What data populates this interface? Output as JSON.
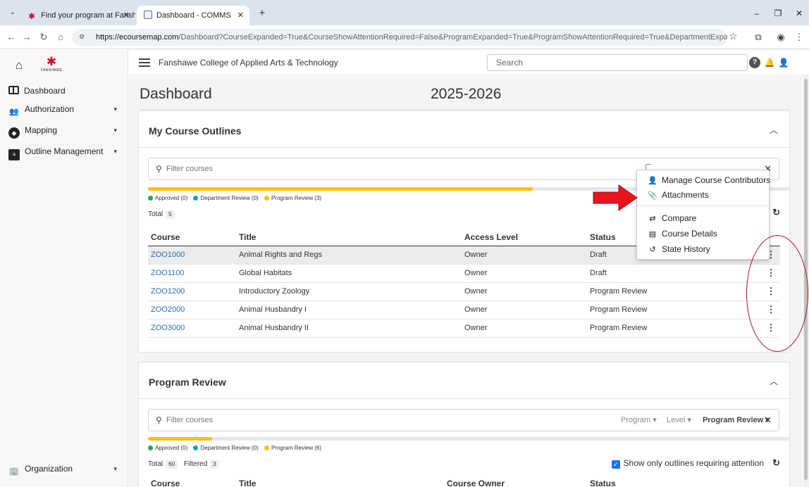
{
  "browser": {
    "tabs": [
      {
        "title": "Find your program at Fanshawe",
        "close": "✕"
      },
      {
        "title": "Dashboard - COMMS",
        "close": "✕"
      }
    ],
    "url_host": "https://ecoursemap.com",
    "url_rest": "/Dashboard?CourseExpanded=True&CourseShowAttentionRequired=False&ProgramExpanded=True&ProgramShowAttentionRequired=True&DepartmentExpanded=True&DepartmentS..."
  },
  "sidebar": {
    "logo_text": "FANSHAWE",
    "items": [
      {
        "label": "Dashboard",
        "icon": "dashboard-icon"
      },
      {
        "label": "Authorization",
        "icon": "users-lock-icon"
      },
      {
        "label": "Mapping",
        "icon": "compass-icon"
      },
      {
        "label": "Outline Management",
        "icon": "book-icon"
      }
    ],
    "footer_item": {
      "label": "Organization",
      "icon": "building-icon"
    }
  },
  "header": {
    "college": "Fanshawe College of Applied Arts & Technology",
    "search_placeholder": "Search"
  },
  "main": {
    "title": "Dashboard",
    "year": "2025-2026"
  },
  "my_outlines": {
    "title": "My Course Outlines",
    "filter_placeholder": "Filter courses",
    "progress_fraction": 0.6,
    "legend": {
      "approved": "Approved (0)",
      "department": "Department Review (0)",
      "program": "Program Review (3)"
    },
    "total_label": "Total",
    "total_count": "5",
    "columns": [
      "Course",
      "Title",
      "Access Level",
      "Status"
    ],
    "rows": [
      {
        "course": "ZOO1000",
        "title": "Animal Rights and Regs",
        "access": "Owner",
        "status": "Draft"
      },
      {
        "course": "ZOO1100",
        "title": "Global Habitats",
        "access": "Owner",
        "status": "Draft"
      },
      {
        "course": "ZOO1200",
        "title": "Introductory Zoology",
        "access": "Owner",
        "status": "Program Review"
      },
      {
        "course": "ZOO2000",
        "title": "Animal Husbandry I",
        "access": "Owner",
        "status": "Program Review"
      },
      {
        "course": "ZOO3000",
        "title": "Animal Husbandry II",
        "access": "Owner",
        "status": "Program Review"
      }
    ]
  },
  "context_menu": {
    "manage": "Manage Course Contributors",
    "attachments": "Attachments",
    "compare": "Compare",
    "details": "Course Details",
    "history": "State History"
  },
  "program_review": {
    "title": "Program Review",
    "filter_placeholder": "Filter courses",
    "dd_program": "Program ▾",
    "dd_level": "Level ▾",
    "dd_status": "Program Review ▾",
    "progress_fraction": 0.1,
    "legend": {
      "approved": "Approved (0)",
      "department": "Department Review (0)",
      "program": "Program Review (6)"
    },
    "total_label": "Total",
    "total_count": "60",
    "filtered_label": "Filtered",
    "filtered_count": "3",
    "attention_label": "Show only outlines requiring attention",
    "columns": [
      "Course",
      "Title",
      "Course Owner",
      "Status"
    ]
  },
  "colors": {
    "approved": "#28a745",
    "department": "#17a2b8",
    "program": "#ffc107",
    "annotation": "#b0141d"
  }
}
